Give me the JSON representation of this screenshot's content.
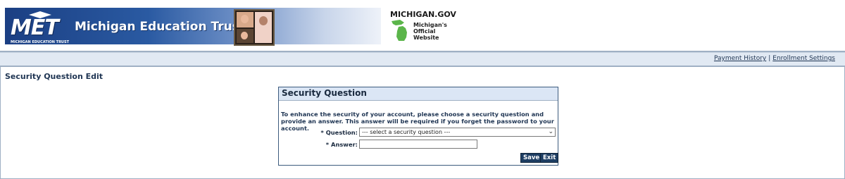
{
  "header": {
    "logo_text": "MET",
    "logo_subtext": "MICHIGAN EDUCATION TRUST",
    "banner_title": "Michigan Education Trust",
    "mi_gov": "MICHIGAN.GOV",
    "mi_site_line1": "Michigan's",
    "mi_site_line2": "Official",
    "mi_site_line3": "Website"
  },
  "nav": {
    "links": [
      "Payment History",
      "Enrollment Settings"
    ],
    "separator": "|"
  },
  "page": {
    "title": "Security Question Edit"
  },
  "panel": {
    "heading": "Security Question",
    "intro": "To enhance the security of your account, please choose a security question and provide an answer. This answer will be required if you forget the password to your account.",
    "question_label": "* Question:",
    "question_value": "--- select a security question ---",
    "answer_label": "* Answer:",
    "answer_value": "",
    "save_label": "Save",
    "exit_label": "Exit"
  },
  "colors": {
    "brand_blue": "#1b3f83",
    "button_bg": "#1e3e63",
    "panel_head_bg": "#dbe6f5",
    "text_dark": "#1f3553"
  }
}
